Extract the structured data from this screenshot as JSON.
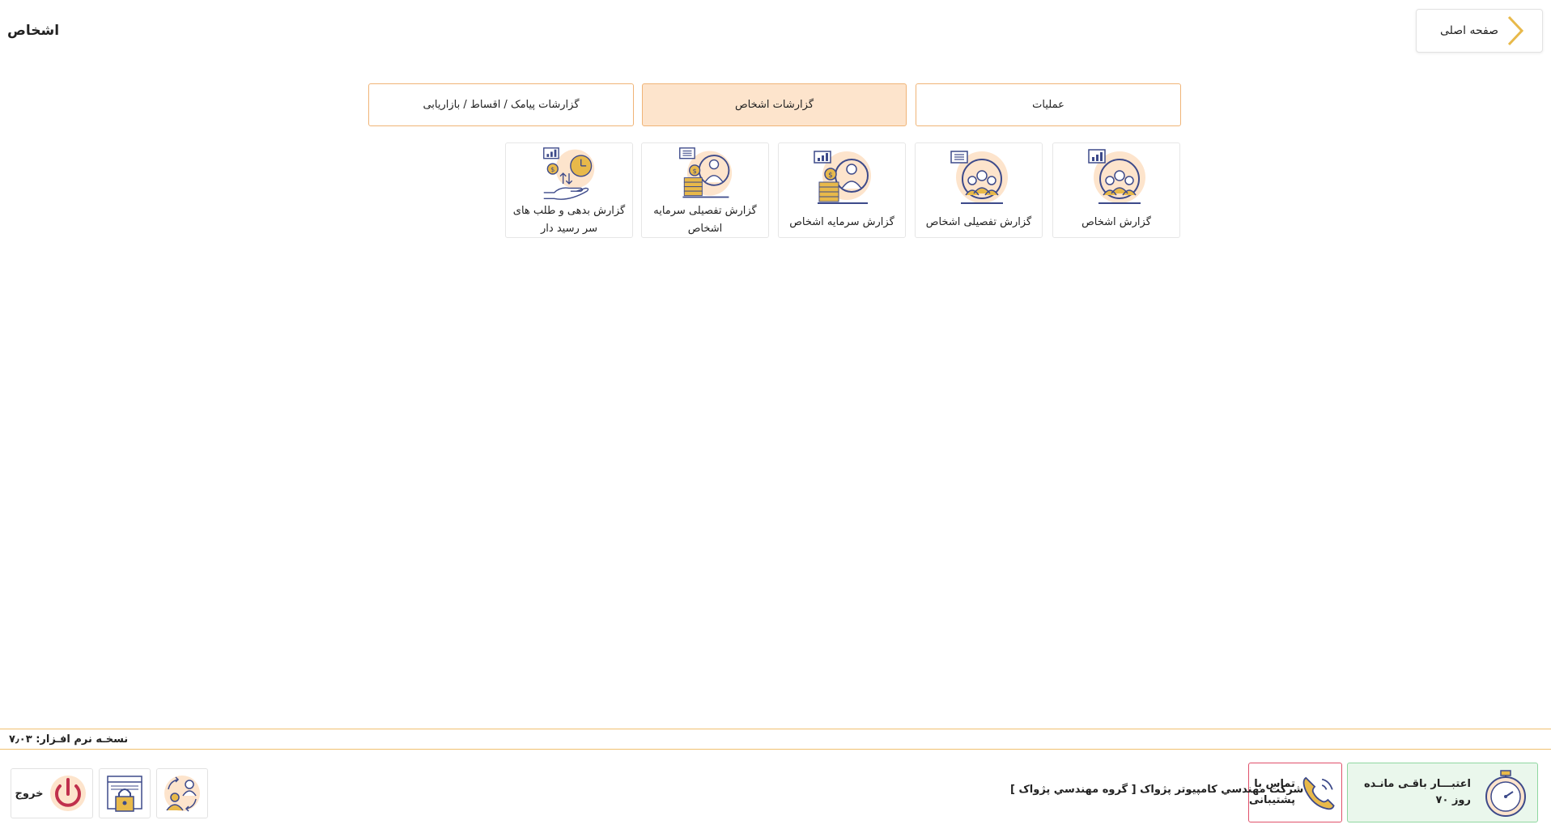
{
  "header": {
    "page_title": "اشخاص",
    "home_label": "صفحه اصلی"
  },
  "tabs": [
    {
      "label": "عملیات",
      "active": false
    },
    {
      "label": "گزارشات اشخاص",
      "active": true
    },
    {
      "label": "گزارشات پیامک / اقساط / بازاریابی",
      "active": false
    }
  ],
  "tiles": [
    {
      "label_line1": "گزارش اشخاص",
      "label_line2": "",
      "icon": "people-chart-icon"
    },
    {
      "label_line1": "گزارش تفصیلی اشخاص",
      "label_line2": "",
      "icon": "people-list-icon"
    },
    {
      "label_line1": "گزارش سرمایه اشخاص",
      "label_line2": "",
      "icon": "person-coins-chart-icon"
    },
    {
      "label_line1": "گزارش تفصیلی سرمایه",
      "label_line2": "اشخاص",
      "icon": "person-coins-list-icon"
    },
    {
      "label_line1": "گزارش بدهی و طلب های",
      "label_line2": "سر رسید دار",
      "icon": "hand-coin-clock-icon"
    }
  ],
  "footer": {
    "version_text": "نسخـه نرم افـزار: ۷٫۰۳",
    "credit_line1": "اعتبـــار باقـی مانـده",
    "credit_line2": "۷۰ روز",
    "support_line1": "تماس با",
    "support_line2": "پشتیبانی",
    "company_text": "شرکت مهندسي کامپیوتر پژواک [ گروه مهندسي پژواک ]",
    "logout_label": "خروج"
  },
  "colors": {
    "accent": "#f0b477",
    "active_tab_bg": "#fde4cc",
    "credit_bg": "#eaf7ec",
    "support_border": "#e0506a",
    "icon_blue": "#3d4a8a",
    "icon_gold": "#e8b94a",
    "icon_peach": "#fde4cc"
  }
}
